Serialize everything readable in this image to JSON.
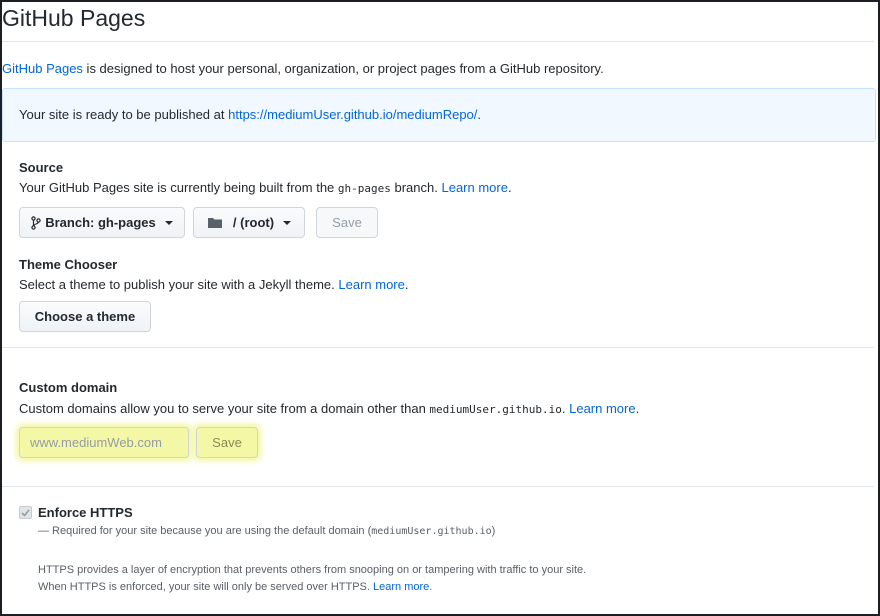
{
  "page": {
    "title": "GitHub Pages",
    "intro": {
      "link": "GitHub Pages",
      "text": " is designed to host your personal, organization, or project pages from a GitHub repository."
    }
  },
  "flash": {
    "prefix": "Your site is ready to be published at ",
    "url": "https://mediumUser.github.io/mediumRepo/",
    "suffix": "."
  },
  "source": {
    "label": "Source",
    "desc_pre": "Your GitHub Pages site is currently being built from the ",
    "branch_code": "gh-pages",
    "desc_post": " branch. ",
    "learn_more": "Learn more",
    "desc_end": ".",
    "branch_button": "Branch: gh-pages",
    "folder_button": "/ (root)",
    "save_button": "Save"
  },
  "theme": {
    "label": "Theme Chooser",
    "desc": "Select a theme to publish your site with a Jekyll theme. ",
    "learn_more": "Learn more",
    "desc_end": ".",
    "button": "Choose a theme"
  },
  "custom_domain": {
    "label": "Custom domain",
    "desc": "Custom domains allow you to serve your site from a domain other than ",
    "domain_code": "mediumUser.github.io",
    "desc_post": ". ",
    "learn_more": "Learn more",
    "desc_end": ".",
    "input_placeholder": "www.mediumWeb.com",
    "save_button": "Save"
  },
  "https": {
    "label": "Enforce HTTPS",
    "required_pre": "— Required for your site because you are using the default domain (",
    "required_code": "mediumUser.github.io",
    "required_post": ")",
    "info_line1": "HTTPS provides a layer of encryption that prevents others from snooping on or tampering with traffic to your site.",
    "info_line2": "When HTTPS is enforced, your site will only be served over HTTPS. ",
    "learn_more": "Learn more",
    "info_end": "."
  },
  "colors": {
    "link": "#0366d6",
    "flash_bg": "#f1f8ff",
    "highlight": "#f4f7a6",
    "text": "#24292e"
  },
  "icons": [
    "branch-icon",
    "folder-icon",
    "caret-down-icon",
    "checkmark-icon"
  ]
}
